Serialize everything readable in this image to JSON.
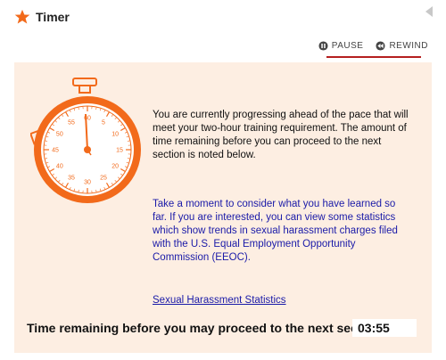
{
  "header": {
    "title": "Timer",
    "icon": "star-icon",
    "back_icon": "triangle-left-icon"
  },
  "controls": {
    "pause_label": "PAUSE",
    "pause_icon": "pause-icon",
    "rewind_label": "REWIND",
    "rewind_icon": "rewind-icon"
  },
  "content": {
    "paragraph1": "You are currently progressing ahead of the pace that will meet your two-hour training requirement. The amount of time remaining before you can proceed to the next section is noted below.",
    "paragraph2": "Take a moment to consider what you have learned so far. If you are interested, you can view some statistics which show trends in sexual harassment charges filed with the U.S. Equal Employment Opportunity Commission (EEOC).",
    "link_text": "Sexual Harassment Statistics"
  },
  "timer": {
    "label": "Time remaining before you may proceed to the next section:",
    "value": "03:55"
  },
  "stopwatch_dial": [
    "60",
    "5",
    "10",
    "15",
    "20",
    "25",
    "30",
    "35",
    "40",
    "45",
    "50",
    "55"
  ],
  "colors": {
    "accent": "#f26a1b",
    "panel": "#fdeee2",
    "link": "#1a1aa8",
    "underline": "#b51f1f"
  }
}
